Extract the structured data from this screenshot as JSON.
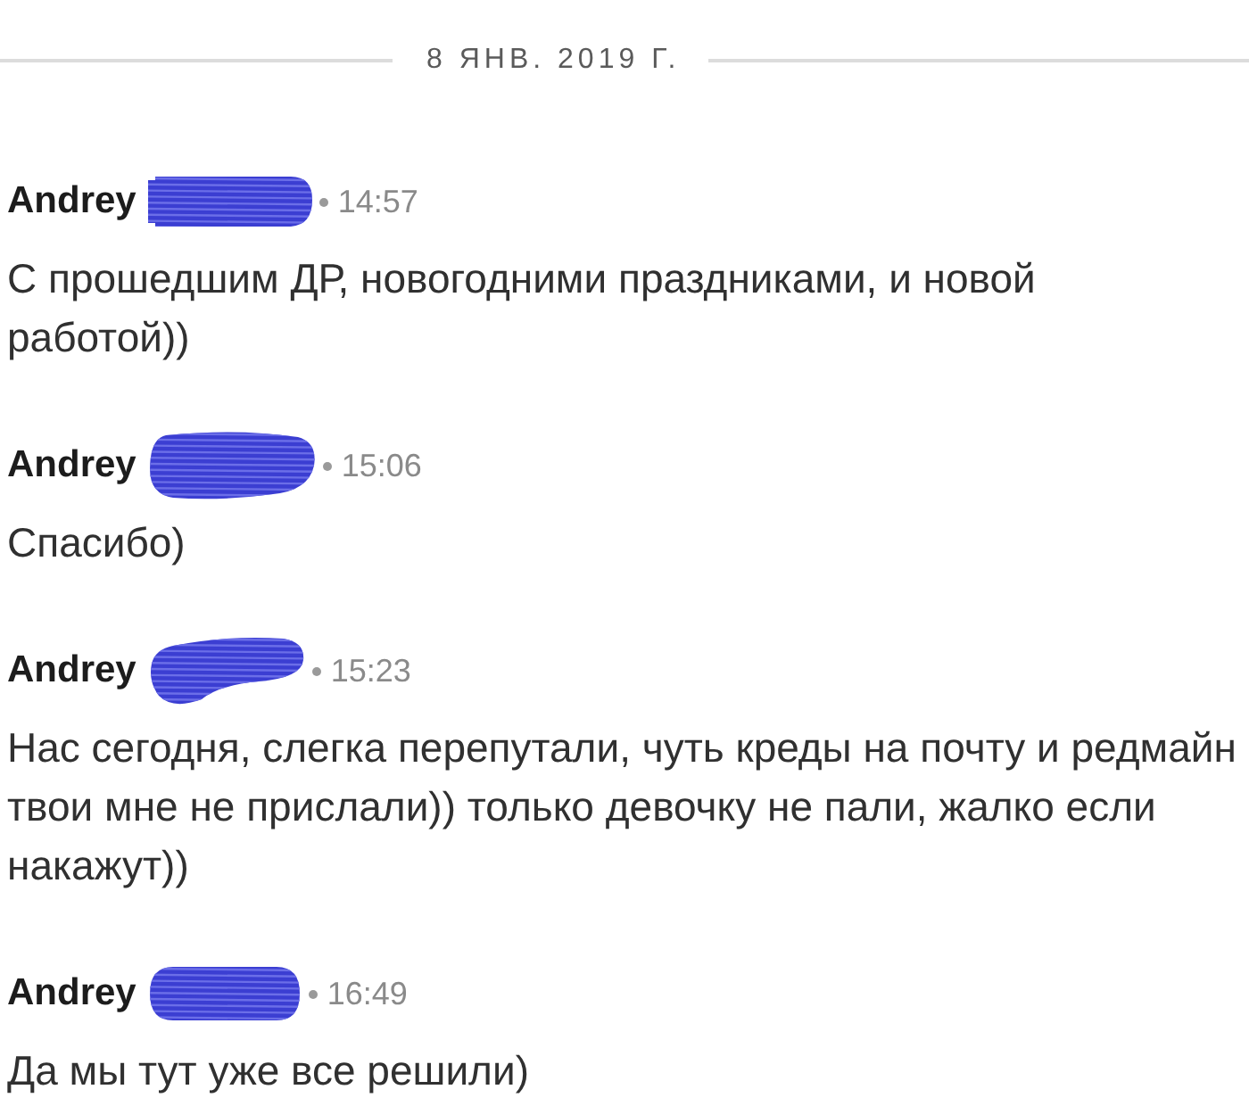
{
  "date_divider": {
    "label": "8 ЯНВ. 2019 Г."
  },
  "messages": [
    {
      "author": "Andrey",
      "name_redacted": true,
      "time": "14:57",
      "text": "С прошедшим ДР, новогодними праздниками, и новой\nработой))"
    },
    {
      "author": "Andrey",
      "name_redacted": true,
      "time": "15:06",
      "text": "Спасибо)"
    },
    {
      "author": "Andrey",
      "name_redacted": true,
      "time": "15:23",
      "text": "Нас сегодня, слегка перепутали, чуть креды на почту и редмайн твои мне не прислали)) только девочку не пали, жалко если накажут))"
    },
    {
      "author": "Andrey",
      "name_redacted": true,
      "time": "16:49",
      "text": "Да мы тут уже все решили)"
    }
  ]
}
